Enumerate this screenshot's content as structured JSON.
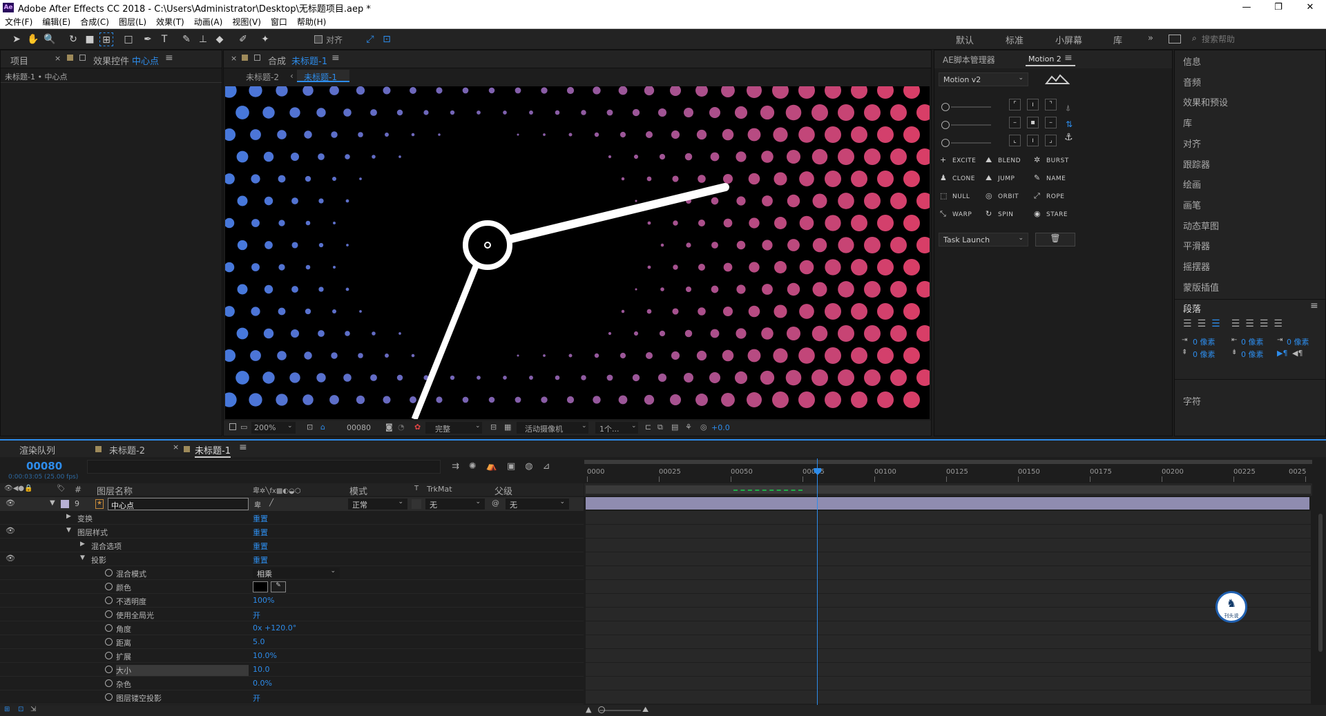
{
  "window": {
    "title": "Adobe After Effects CC 2018 - C:\\Users\\Administrator\\Desktop\\无标题项目.aep *",
    "min": "—",
    "max": "❐",
    "close": "✕"
  },
  "menu": [
    "文件(F)",
    "编辑(E)",
    "合成(C)",
    "图层(L)",
    "效果(T)",
    "动画(A)",
    "视图(V)",
    "窗口",
    "帮助(H)"
  ],
  "toolbar": {
    "snap_label": "对齐",
    "workspaces": [
      "默认",
      "标准",
      "小屏幕",
      "库"
    ],
    "more": "»",
    "search_placeholder": "搜索帮助"
  },
  "left_panel": {
    "tab_project": "项目",
    "tab_effects": "效果控件",
    "tab_effects_layer": "中心点",
    "breadcrumb": "未标题-1 • 中心点"
  },
  "comp_panel": {
    "tab_label": "合成",
    "tab_comp": "未标题-1",
    "sub_tab_prev": "未标题-2",
    "sub_tab_active": "未标题-1",
    "zoom": "200%",
    "timecode": "00080",
    "quality": "完整",
    "camera": "活动摄像机",
    "views": "1个...",
    "exposure": "+0.0"
  },
  "script_panel": {
    "tab1": "AE脚本管理器",
    "tab2": "Motion 2",
    "select": "Motion v2",
    "buttons": [
      [
        "EXCITE",
        "BLEND",
        "BURST"
      ],
      [
        "CLONE",
        "JUMP",
        "NAME"
      ],
      [
        "NULL",
        "ORBIT",
        "ROPE"
      ],
      [
        "WARP",
        "SPIN",
        "STARE"
      ]
    ],
    "task_select": "Task Launch"
  },
  "right_panel": {
    "items": [
      "信息",
      "音频",
      "效果和预设",
      "库",
      "对齐",
      "跟踪器",
      "绘画",
      "画笔",
      "动态草图",
      "平滑器",
      "摇摆器",
      "蒙版插值"
    ],
    "paragraph_title": "段落",
    "px_values": [
      "0 像素",
      "0 像素",
      "0 像素",
      "0 像素",
      "0 像素"
    ],
    "char_title": "字符"
  },
  "timeline": {
    "tabs": [
      "渲染队列",
      "未标题-2",
      "未标题-1"
    ],
    "current_time": "00080",
    "time_sub": "0:00:03:05 (25.00 fps)",
    "columns": {
      "num": "#",
      "name": "图层名称",
      "mode": "模式",
      "trkmat_t": "T",
      "trkmat": "TrkMat",
      "parent": "父级"
    },
    "layer": {
      "num": "9",
      "name": "中心点",
      "mode": "正常",
      "trkmat": "无",
      "parent": "无"
    },
    "props": [
      {
        "indent": 1,
        "arrow": "▶",
        "label": "变换",
        "value": "重置",
        "eye": false
      },
      {
        "indent": 1,
        "arrow": "▼",
        "label": "图层样式",
        "value": "重置",
        "eye": true
      },
      {
        "indent": 2,
        "arrow": "▶",
        "label": "混合选项",
        "value": "重置",
        "eye": false
      },
      {
        "indent": 2,
        "arrow": "▼",
        "label": "投影",
        "value": "重置",
        "eye": true
      },
      {
        "indent": 3,
        "arrow": "",
        "label": "混合模式",
        "value": "相乘",
        "eye": false,
        "select": true
      },
      {
        "indent": 3,
        "arrow": "",
        "label": "颜色",
        "value": "",
        "eye": false,
        "color": true
      },
      {
        "indent": 3,
        "arrow": "",
        "label": "不透明度",
        "value": "100%",
        "eye": false
      },
      {
        "indent": 3,
        "arrow": "",
        "label": "使用全局光",
        "value": "开",
        "eye": false
      },
      {
        "indent": 3,
        "arrow": "",
        "label": "角度",
        "value": "0x +120.0°",
        "eye": false
      },
      {
        "indent": 3,
        "arrow": "",
        "label": "距离",
        "value": "5.0",
        "eye": false
      },
      {
        "indent": 3,
        "arrow": "",
        "label": "扩展",
        "value": "10.0%",
        "eye": false
      },
      {
        "indent": 3,
        "arrow": "",
        "label": "大小",
        "value": "10.0",
        "eye": false,
        "highlight": true
      },
      {
        "indent": 3,
        "arrow": "",
        "label": "杂色",
        "value": "0.0%",
        "eye": false
      },
      {
        "indent": 3,
        "arrow": "",
        "label": "图层镂空投影",
        "value": "开",
        "eye": false
      }
    ],
    "ruler": [
      "0000",
      "00025",
      "00050",
      "00075",
      "00100",
      "00125",
      "00150",
      "00175",
      "00200",
      "00225",
      "0025"
    ],
    "playhead_fraction": 0.32
  },
  "watermark_text": "刊头说"
}
